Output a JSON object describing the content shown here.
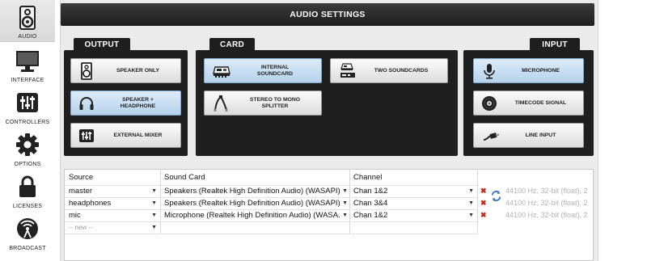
{
  "sidebar": {
    "items": [
      {
        "label": "AUDIO",
        "icon": "speaker-icon",
        "active": true
      },
      {
        "label": "INTERFACE",
        "icon": "monitor-icon",
        "active": false
      },
      {
        "label": "CONTROLLERS",
        "icon": "mixer-sliders-icon",
        "active": false
      },
      {
        "label": "OPTIONS",
        "icon": "gear-icon",
        "active": false
      },
      {
        "label": "LICENSES",
        "icon": "lock-icon",
        "active": false
      },
      {
        "label": "BROADCAST",
        "icon": "broadcast-icon",
        "active": false
      }
    ]
  },
  "header": {
    "title": "AUDIO SETTINGS"
  },
  "output": {
    "tab": "OUTPUT",
    "buttons": [
      {
        "label1": "SPEAKER ONLY",
        "label2": "",
        "icon": "speaker-icon",
        "selected": false
      },
      {
        "label1": "SPEAKER +",
        "label2": "HEADPHONE",
        "icon": "headphone-icon",
        "selected": true
      },
      {
        "label1": "EXTERNAL MIXER",
        "label2": "",
        "icon": "mixer-icon",
        "selected": false
      }
    ]
  },
  "card": {
    "tab": "CARD",
    "buttons": [
      {
        "label1": "INTERNAL",
        "label2": "SOUNDCARD",
        "icon": "soundcard-icon",
        "selected": true
      },
      {
        "label1": "TWO SOUNDCARDS",
        "label2": "",
        "icon": "two-soundcards-icon",
        "selected": false
      },
      {
        "label1": "STEREO TO MONO",
        "label2": "SPLITTER",
        "icon": "splitter-cable-icon",
        "selected": false
      }
    ]
  },
  "input": {
    "tab": "INPUT",
    "buttons": [
      {
        "label1": "MICROPHONE",
        "label2": "",
        "icon": "microphone-icon",
        "selected": true
      },
      {
        "label1": "TIMECODE SIGNAL",
        "label2": "",
        "icon": "vinyl-icon",
        "selected": false
      },
      {
        "label1": "LINE INPUT",
        "label2": "",
        "icon": "line-cable-icon",
        "selected": false
      }
    ]
  },
  "table": {
    "headers": {
      "source": "Source",
      "soundcard": "Sound Card",
      "channel": "Channel"
    },
    "rows": [
      {
        "source": "master",
        "soundcard": "Speakers (Realtek High Definition Audio) (WASAPI)",
        "channel": "Chan 1&2",
        "info": "44100 Hz, 32-bit (float), 2"
      },
      {
        "source": "headphones",
        "soundcard": "Speakers (Realtek High Definition Audio) (WASAPI)",
        "channel": "Chan 3&4",
        "info": "44100 Hz, 32-bit (float), 2"
      },
      {
        "source": "mic",
        "soundcard": "Microphone (Realtek High Definition Audio) (WASA...",
        "channel": "Chan 1&2",
        "info": "44100 Hz, 32-bit (float), 2"
      }
    ],
    "new_row": "-- new --"
  },
  "colors": {
    "panel": "#1f1f1f",
    "selected_button": "#c6dcf1",
    "remove": "#c0281b"
  }
}
